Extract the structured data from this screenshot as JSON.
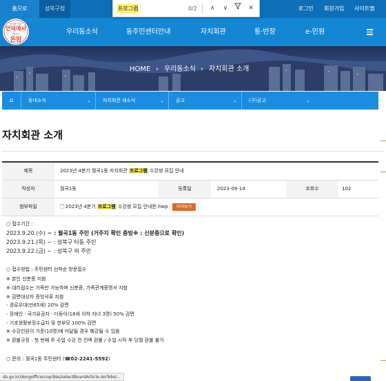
{
  "topbar": {
    "home_tab": "홈으로",
    "gu_tab": "성북구청",
    "login": "로그인",
    "signup": "회원가입",
    "sitemap": "사이트맵"
  },
  "find": {
    "query": "프로그램",
    "count": "0/2"
  },
  "logo": {
    "line1": "정겨운 이웃",
    "line2": "언덕에서",
    "line3": "만나는",
    "line4": "돈암"
  },
  "nav": {
    "items": [
      "우리동소식",
      "동주민센터안내",
      "자치회관",
      "통·반장",
      "e-민원"
    ]
  },
  "breadcrumb": {
    "home": "HOME",
    "level1": "우리동소식",
    "level2": "자치회관 소개"
  },
  "submenu": {
    "items": [
      "동네소식",
      "자치회관 새소식",
      "공고",
      "(구)공고"
    ]
  },
  "page_title": "자치회관 소개",
  "table": {
    "subject_label": "제목",
    "subject_before": "2023년 4분기 월곡1동 자치회관 ",
    "subject_hl": "프로그램",
    "subject_after": " 수강생 모집 안내",
    "author_label": "작성자",
    "author": "월곡1동",
    "date_label": "등록일",
    "date": "2023-09-14",
    "views_label": "조회수",
    "views": "102",
    "attach_label": "첨부파일",
    "attach_before": "2023년 4분기 ",
    "attach_hl": "프로그램",
    "attach_after": " 수강생 모집 안내문.hwp",
    "preview_btn": "미리보기"
  },
  "content": {
    "l1": "○ 접수기간 :",
    "l2a": "2023.9.20.(수)",
    "l2b": " ~ : 월곡1동 주민 (거주지 확인 증빙※ : 신분증으로 확인)",
    "l3a": "2023.9.21.(목)",
    "l3b": " ~ : 성북구 타동 주민",
    "l4a": "2023.9.22.(금)",
    "l4b": " ~ : 성북구 외 주민",
    "l5": "○ 접수방법 : 주민센터 선착순 방문접수",
    "l6": "※ 본인 신분증 지참",
    "l7": "※ 대리접수는 가족만 가능하며 신분증, 가족관계증명서 지참",
    "l8": "※ 감면대상자 증빙서류 지참",
    "l9": "- 경로우대(만65세) 20% 감면",
    "l10": "- 장애인 · 국가유공자 · 다둥이(18세 이하 자녀 3명) 50% 감면",
    "l11": "- 기초생활보장수급자 및 한부모 100% 감면",
    "l12": "※ 수강인원이 기준(10명)에 미달될 경우 폐강될 수 있음",
    "l13": "※ 환불규정 : 첫 번째 주 수업 수강 전 전액 환불 / 수업 시작 후 당월 환불 불가",
    "l14a": "○ 문의 : 월곡1동 주민센터 (",
    "l14b": "☎02-2241-5592",
    "l14c": ")"
  },
  "status_url": "sb.go.kr/dongoffice/cop/bbs/selectBoardArticle.do?bbsI...",
  "colors": {
    "nav": "#1487d4",
    "topbar": "#0c6fb7",
    "highlight": "#fff066",
    "preview": "#d96a2a"
  }
}
